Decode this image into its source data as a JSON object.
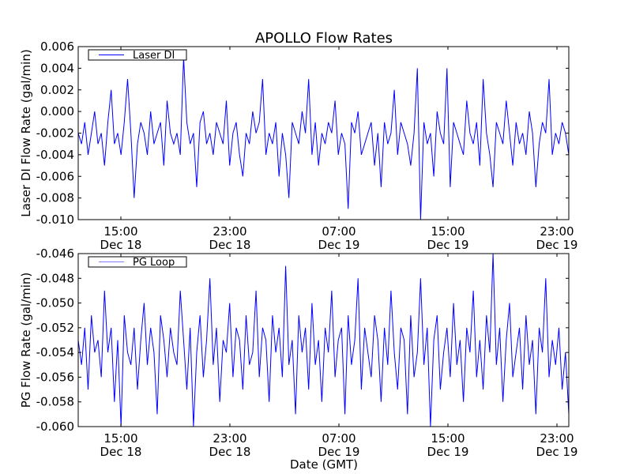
{
  "chart_data": {
    "type": "line",
    "title": "APOLLO Flow Rates",
    "xlabel": "Date (GMT)",
    "x_units": "hours since Dec 18 00:00 GMT",
    "xlim": [
      11.87,
      47.87
    ],
    "x_start": 11.87,
    "x_step": 0.2416,
    "x_ticks": [
      {
        "value": 15,
        "time": "15:00",
        "date": "Dec 18"
      },
      {
        "value": 23,
        "time": "23:00",
        "date": "Dec 18"
      },
      {
        "value": 31,
        "time": "07:00",
        "date": "Dec 19"
      },
      {
        "value": 39,
        "time": "15:00",
        "date": "Dec 19"
      },
      {
        "value": 47,
        "time": "23:00",
        "date": "Dec 19"
      }
    ],
    "panels": [
      {
        "ylabel": "Laser DI Flow Rate (gal/min)",
        "ylim": [
          -0.01,
          0.006
        ],
        "y_ticks": [
          "0.006",
          "0.004",
          "0.002",
          "0.000",
          "-0.002",
          "-0.004",
          "-0.006",
          "-0.008",
          "-0.010"
        ],
        "legend": {
          "label": "Laser DI",
          "placement": "top-left"
        },
        "series": [
          {
            "name": "Laser DI",
            "color": "#0000ff",
            "values": [
              -0.002,
              -0.003,
              -0.001,
              -0.004,
              -0.002,
              0.0,
              -0.003,
              -0.002,
              -0.005,
              -0.001,
              0.002,
              -0.003,
              -0.002,
              -0.004,
              -0.001,
              0.003,
              -0.002,
              -0.008,
              -0.003,
              -0.001,
              -0.002,
              -0.004,
              0.0,
              -0.003,
              -0.002,
              -0.001,
              -0.005,
              0.001,
              -0.002,
              -0.003,
              -0.002,
              -0.004,
              0.005,
              -0.001,
              -0.003,
              -0.002,
              -0.007,
              -0.001,
              0.0,
              -0.003,
              -0.002,
              -0.004,
              -0.001,
              -0.002,
              -0.003,
              0.001,
              -0.005,
              -0.002,
              -0.001,
              -0.004,
              -0.006,
              -0.002,
              -0.003,
              0.0,
              -0.002,
              -0.001,
              0.003,
              -0.004,
              -0.002,
              -0.003,
              -0.001,
              -0.006,
              -0.002,
              -0.004,
              -0.008,
              -0.001,
              -0.002,
              -0.003,
              0.0,
              -0.002,
              0.003,
              -0.004,
              -0.001,
              -0.005,
              -0.002,
              -0.003,
              -0.001,
              -0.002,
              0.001,
              -0.004,
              -0.002,
              -0.003,
              -0.009,
              -0.001,
              -0.002,
              0.0,
              -0.004,
              -0.003,
              -0.002,
              -0.001,
              -0.005,
              -0.002,
              -0.007,
              -0.001,
              -0.003,
              -0.002,
              0.002,
              -0.004,
              -0.001,
              -0.002,
              -0.003,
              -0.005,
              -0.002,
              0.004,
              -0.01,
              -0.001,
              -0.003,
              -0.002,
              -0.006,
              0.0,
              -0.002,
              -0.003,
              0.004,
              -0.007,
              -0.001,
              -0.002,
              -0.003,
              -0.004,
              0.001,
              -0.002,
              -0.003,
              -0.001,
              -0.005,
              0.003,
              -0.002,
              -0.004,
              -0.007,
              -0.001,
              -0.002,
              -0.003,
              0.001,
              -0.002,
              -0.005,
              -0.001,
              -0.003,
              -0.002,
              -0.004,
              0.0,
              -0.002,
              -0.007,
              -0.003,
              -0.001,
              -0.002,
              0.003,
              -0.004,
              -0.002,
              -0.003,
              -0.001,
              -0.002,
              -0.004
            ]
          }
        ]
      },
      {
        "ylabel": "PG Flow Rate (gal/min)",
        "ylim": [
          -0.06,
          -0.046
        ],
        "y_ticks": [
          "-0.046",
          "-0.048",
          "-0.050",
          "-0.052",
          "-0.054",
          "-0.056",
          "-0.058",
          "-0.060"
        ],
        "legend": {
          "label": "PG Loop",
          "placement": "top-left"
        },
        "series": [
          {
            "name": "PG Loop",
            "color": "#0000ff",
            "values": [
              -0.053,
              -0.055,
              -0.052,
              -0.057,
              -0.051,
              -0.054,
              -0.053,
              -0.056,
              -0.049,
              -0.054,
              -0.052,
              -0.058,
              -0.053,
              -0.06,
              -0.051,
              -0.054,
              -0.055,
              -0.052,
              -0.057,
              -0.053,
              -0.05,
              -0.055,
              -0.052,
              -0.054,
              -0.059,
              -0.051,
              -0.053,
              -0.056,
              -0.052,
              -0.054,
              -0.055,
              -0.049,
              -0.053,
              -0.057,
              -0.052,
              -0.06,
              -0.054,
              -0.051,
              -0.056,
              -0.053,
              -0.048,
              -0.055,
              -0.052,
              -0.058,
              -0.053,
              -0.054,
              -0.05,
              -0.056,
              -0.052,
              -0.053,
              -0.057,
              -0.051,
              -0.055,
              -0.054,
              -0.049,
              -0.056,
              -0.052,
              -0.053,
              -0.058,
              -0.051,
              -0.054,
              -0.052,
              -0.056,
              -0.047,
              -0.055,
              -0.053,
              -0.059,
              -0.051,
              -0.054,
              -0.052,
              -0.057,
              -0.05,
              -0.055,
              -0.053,
              -0.058,
              -0.052,
              -0.054,
              -0.049,
              -0.056,
              -0.053,
              -0.052,
              -0.059,
              -0.051,
              -0.055,
              -0.053,
              -0.048,
              -0.057,
              -0.052,
              -0.054,
              -0.056,
              -0.051,
              -0.053,
              -0.058,
              -0.052,
              -0.055,
              -0.049,
              -0.054,
              -0.057,
              -0.052,
              -0.053,
              -0.059,
              -0.051,
              -0.056,
              -0.054,
              -0.048,
              -0.055,
              -0.052,
              -0.06,
              -0.053,
              -0.051,
              -0.057,
              -0.054,
              -0.052,
              -0.056,
              -0.05,
              -0.055,
              -0.053,
              -0.058,
              -0.052,
              -0.054,
              -0.049,
              -0.056,
              -0.053,
              -0.057,
              -0.051,
              -0.054,
              -0.046,
              -0.055,
              -0.052,
              -0.058,
              -0.053,
              -0.05,
              -0.056,
              -0.054,
              -0.052,
              -0.057,
              -0.051,
              -0.055,
              -0.053,
              -0.059,
              -0.052,
              -0.054,
              -0.048,
              -0.056,
              -0.053,
              -0.055,
              -0.052,
              -0.057,
              -0.054,
              -0.059
            ]
          }
        ]
      }
    ]
  }
}
